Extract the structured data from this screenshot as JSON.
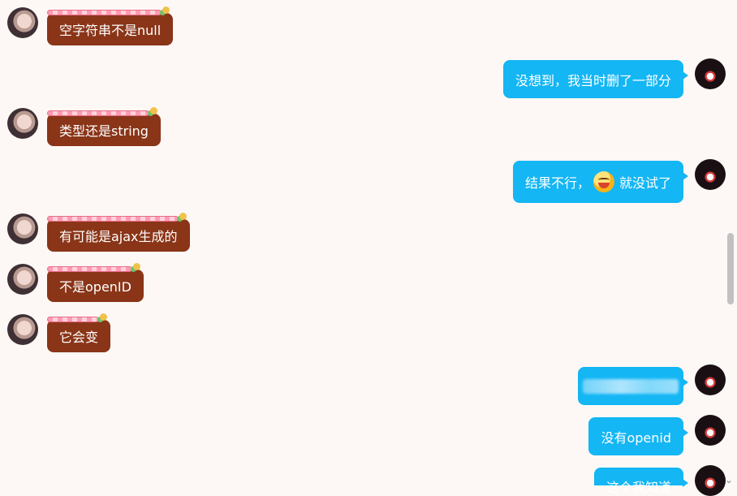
{
  "theme": {
    "background": "#fdf8f5",
    "incoming_bubble": "#8a3518",
    "outgoing_bubble": "#14b6f4",
    "bubble_text": "#ffffff"
  },
  "messages": [
    {
      "side": "incoming",
      "text": "空字符串不是null"
    },
    {
      "side": "outgoing",
      "text": "没想到，我当时删了一部分"
    },
    {
      "side": "incoming",
      "text": "类型还是string"
    },
    {
      "side": "outgoing",
      "text_before": "结果不行，",
      "emoji": "laughing-face-emoji",
      "text_after": "就没试了"
    },
    {
      "side": "incoming",
      "text": "有可能是ajax生成的"
    },
    {
      "side": "incoming",
      "text": "不是openID"
    },
    {
      "side": "incoming",
      "text": "它会变"
    },
    {
      "side": "outgoing",
      "text": "",
      "redacted": true
    },
    {
      "side": "outgoing",
      "text": "没有openid"
    },
    {
      "side": "outgoing",
      "text": "这个我知道"
    }
  ],
  "icons": {
    "scroll_down": "chevron-down-icon"
  },
  "glyphs": {
    "chevron": "⌄"
  }
}
